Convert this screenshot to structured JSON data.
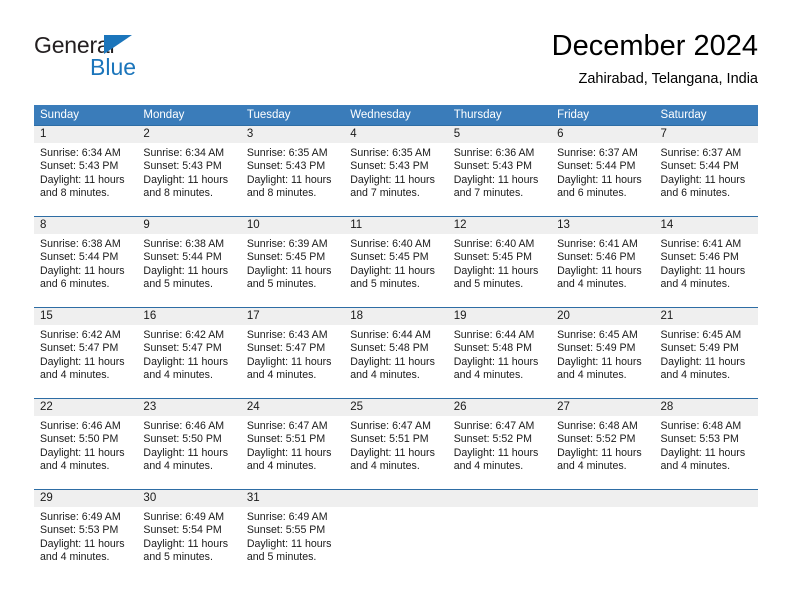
{
  "brand": {
    "name_part1": "General",
    "name_part2": "Blue",
    "triangle_icon": "triangle-icon",
    "accent_color": "#1b75bb"
  },
  "header": {
    "title": "December 2024",
    "location": "Zahirabad, Telangana, India"
  },
  "calendar": {
    "header_bg": "#3a7cba",
    "row_border_color": "#2e6da4",
    "daynum_band_bg": "#efefef",
    "weekday_headers": [
      "Sunday",
      "Monday",
      "Tuesday",
      "Wednesday",
      "Thursday",
      "Friday",
      "Saturday"
    ],
    "weeks": [
      [
        {
          "day": "1",
          "sunrise": "Sunrise: 6:34 AM",
          "sunset": "Sunset: 5:43 PM",
          "daylight_line1": "Daylight: 11 hours",
          "daylight_line2": "and 8 minutes."
        },
        {
          "day": "2",
          "sunrise": "Sunrise: 6:34 AM",
          "sunset": "Sunset: 5:43 PM",
          "daylight_line1": "Daylight: 11 hours",
          "daylight_line2": "and 8 minutes."
        },
        {
          "day": "3",
          "sunrise": "Sunrise: 6:35 AM",
          "sunset": "Sunset: 5:43 PM",
          "daylight_line1": "Daylight: 11 hours",
          "daylight_line2": "and 8 minutes."
        },
        {
          "day": "4",
          "sunrise": "Sunrise: 6:35 AM",
          "sunset": "Sunset: 5:43 PM",
          "daylight_line1": "Daylight: 11 hours",
          "daylight_line2": "and 7 minutes."
        },
        {
          "day": "5",
          "sunrise": "Sunrise: 6:36 AM",
          "sunset": "Sunset: 5:43 PM",
          "daylight_line1": "Daylight: 11 hours",
          "daylight_line2": "and 7 minutes."
        },
        {
          "day": "6",
          "sunrise": "Sunrise: 6:37 AM",
          "sunset": "Sunset: 5:44 PM",
          "daylight_line1": "Daylight: 11 hours",
          "daylight_line2": "and 6 minutes."
        },
        {
          "day": "7",
          "sunrise": "Sunrise: 6:37 AM",
          "sunset": "Sunset: 5:44 PM",
          "daylight_line1": "Daylight: 11 hours",
          "daylight_line2": "and 6 minutes."
        }
      ],
      [
        {
          "day": "8",
          "sunrise": "Sunrise: 6:38 AM",
          "sunset": "Sunset: 5:44 PM",
          "daylight_line1": "Daylight: 11 hours",
          "daylight_line2": "and 6 minutes."
        },
        {
          "day": "9",
          "sunrise": "Sunrise: 6:38 AM",
          "sunset": "Sunset: 5:44 PM",
          "daylight_line1": "Daylight: 11 hours",
          "daylight_line2": "and 5 minutes."
        },
        {
          "day": "10",
          "sunrise": "Sunrise: 6:39 AM",
          "sunset": "Sunset: 5:45 PM",
          "daylight_line1": "Daylight: 11 hours",
          "daylight_line2": "and 5 minutes."
        },
        {
          "day": "11",
          "sunrise": "Sunrise: 6:40 AM",
          "sunset": "Sunset: 5:45 PM",
          "daylight_line1": "Daylight: 11 hours",
          "daylight_line2": "and 5 minutes."
        },
        {
          "day": "12",
          "sunrise": "Sunrise: 6:40 AM",
          "sunset": "Sunset: 5:45 PM",
          "daylight_line1": "Daylight: 11 hours",
          "daylight_line2": "and 5 minutes."
        },
        {
          "day": "13",
          "sunrise": "Sunrise: 6:41 AM",
          "sunset": "Sunset: 5:46 PM",
          "daylight_line1": "Daylight: 11 hours",
          "daylight_line2": "and 4 minutes."
        },
        {
          "day": "14",
          "sunrise": "Sunrise: 6:41 AM",
          "sunset": "Sunset: 5:46 PM",
          "daylight_line1": "Daylight: 11 hours",
          "daylight_line2": "and 4 minutes."
        }
      ],
      [
        {
          "day": "15",
          "sunrise": "Sunrise: 6:42 AM",
          "sunset": "Sunset: 5:47 PM",
          "daylight_line1": "Daylight: 11 hours",
          "daylight_line2": "and 4 minutes."
        },
        {
          "day": "16",
          "sunrise": "Sunrise: 6:42 AM",
          "sunset": "Sunset: 5:47 PM",
          "daylight_line1": "Daylight: 11 hours",
          "daylight_line2": "and 4 minutes."
        },
        {
          "day": "17",
          "sunrise": "Sunrise: 6:43 AM",
          "sunset": "Sunset: 5:47 PM",
          "daylight_line1": "Daylight: 11 hours",
          "daylight_line2": "and 4 minutes."
        },
        {
          "day": "18",
          "sunrise": "Sunrise: 6:44 AM",
          "sunset": "Sunset: 5:48 PM",
          "daylight_line1": "Daylight: 11 hours",
          "daylight_line2": "and 4 minutes."
        },
        {
          "day": "19",
          "sunrise": "Sunrise: 6:44 AM",
          "sunset": "Sunset: 5:48 PM",
          "daylight_line1": "Daylight: 11 hours",
          "daylight_line2": "and 4 minutes."
        },
        {
          "day": "20",
          "sunrise": "Sunrise: 6:45 AM",
          "sunset": "Sunset: 5:49 PM",
          "daylight_line1": "Daylight: 11 hours",
          "daylight_line2": "and 4 minutes."
        },
        {
          "day": "21",
          "sunrise": "Sunrise: 6:45 AM",
          "sunset": "Sunset: 5:49 PM",
          "daylight_line1": "Daylight: 11 hours",
          "daylight_line2": "and 4 minutes."
        }
      ],
      [
        {
          "day": "22",
          "sunrise": "Sunrise: 6:46 AM",
          "sunset": "Sunset: 5:50 PM",
          "daylight_line1": "Daylight: 11 hours",
          "daylight_line2": "and 4 minutes."
        },
        {
          "day": "23",
          "sunrise": "Sunrise: 6:46 AM",
          "sunset": "Sunset: 5:50 PM",
          "daylight_line1": "Daylight: 11 hours",
          "daylight_line2": "and 4 minutes."
        },
        {
          "day": "24",
          "sunrise": "Sunrise: 6:47 AM",
          "sunset": "Sunset: 5:51 PM",
          "daylight_line1": "Daylight: 11 hours",
          "daylight_line2": "and 4 minutes."
        },
        {
          "day": "25",
          "sunrise": "Sunrise: 6:47 AM",
          "sunset": "Sunset: 5:51 PM",
          "daylight_line1": "Daylight: 11 hours",
          "daylight_line2": "and 4 minutes."
        },
        {
          "day": "26",
          "sunrise": "Sunrise: 6:47 AM",
          "sunset": "Sunset: 5:52 PM",
          "daylight_line1": "Daylight: 11 hours",
          "daylight_line2": "and 4 minutes."
        },
        {
          "day": "27",
          "sunrise": "Sunrise: 6:48 AM",
          "sunset": "Sunset: 5:52 PM",
          "daylight_line1": "Daylight: 11 hours",
          "daylight_line2": "and 4 minutes."
        },
        {
          "day": "28",
          "sunrise": "Sunrise: 6:48 AM",
          "sunset": "Sunset: 5:53 PM",
          "daylight_line1": "Daylight: 11 hours",
          "daylight_line2": "and 4 minutes."
        }
      ],
      [
        {
          "day": "29",
          "sunrise": "Sunrise: 6:49 AM",
          "sunset": "Sunset: 5:53 PM",
          "daylight_line1": "Daylight: 11 hours",
          "daylight_line2": "and 4 minutes."
        },
        {
          "day": "30",
          "sunrise": "Sunrise: 6:49 AM",
          "sunset": "Sunset: 5:54 PM",
          "daylight_line1": "Daylight: 11 hours",
          "daylight_line2": "and 5 minutes."
        },
        {
          "day": "31",
          "sunrise": "Sunrise: 6:49 AM",
          "sunset": "Sunset: 5:55 PM",
          "daylight_line1": "Daylight: 11 hours",
          "daylight_line2": "and 5 minutes."
        },
        {
          "day": "",
          "sunrise": "",
          "sunset": "",
          "daylight_line1": "",
          "daylight_line2": ""
        },
        {
          "day": "",
          "sunrise": "",
          "sunset": "",
          "daylight_line1": "",
          "daylight_line2": ""
        },
        {
          "day": "",
          "sunrise": "",
          "sunset": "",
          "daylight_line1": "",
          "daylight_line2": ""
        },
        {
          "day": "",
          "sunrise": "",
          "sunset": "",
          "daylight_line1": "",
          "daylight_line2": ""
        }
      ]
    ]
  }
}
